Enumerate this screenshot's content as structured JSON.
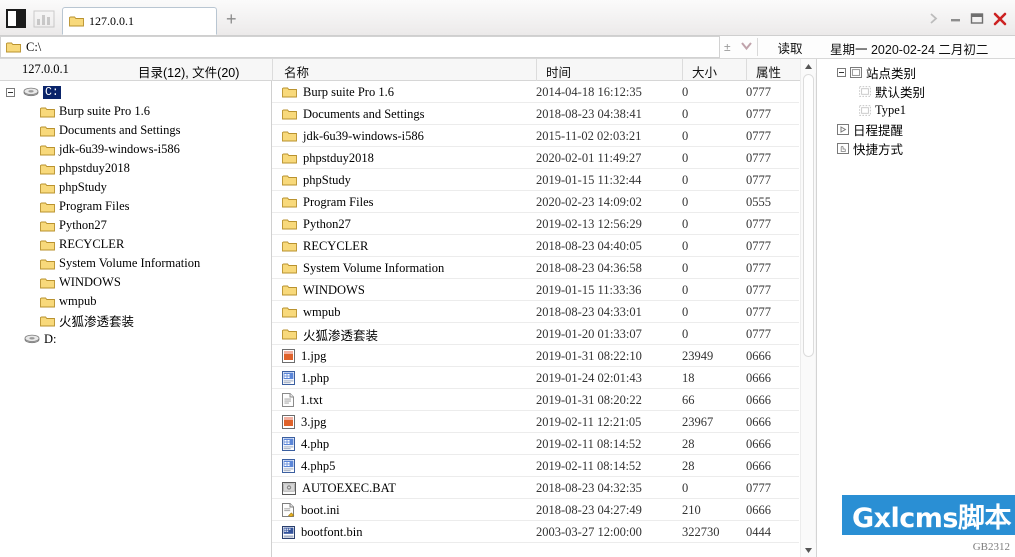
{
  "window": {
    "tab_label": "127.0.0.1",
    "new_tab_label": "+",
    "controls": {
      "expand": "»",
      "minimize": "–",
      "maximize": "□",
      "close": "✕"
    }
  },
  "address": {
    "path": "C:\\",
    "plus_minus": "±",
    "chevron": "⌄",
    "read_button": "读取",
    "date_text": "星期一 2020-02-24 二月初二"
  },
  "subheader": {
    "host": "127.0.0.1",
    "counts": "目录(12), 文件(20)"
  },
  "columns": {
    "name": "名称",
    "time": "时间",
    "size": "大小",
    "attr": "属性"
  },
  "tree": {
    "drives": [
      {
        "label": "C:",
        "selected": true,
        "expanded": true,
        "children": [
          {
            "label": "Burp suite Pro 1.6",
            "cjk": false
          },
          {
            "label": "Documents and Settings",
            "cjk": false
          },
          {
            "label": "jdk-6u39-windows-i586",
            "cjk": false
          },
          {
            "label": "phpstduy2018",
            "cjk": false
          },
          {
            "label": "phpStudy",
            "cjk": false
          },
          {
            "label": "Program Files",
            "cjk": false
          },
          {
            "label": "Python27",
            "cjk": false
          },
          {
            "label": "RECYCLER",
            "cjk": false
          },
          {
            "label": "System Volume Information",
            "cjk": false
          },
          {
            "label": "WINDOWS",
            "cjk": false
          },
          {
            "label": "wmpub",
            "cjk": false
          },
          {
            "label": "火狐渗透套装",
            "cjk": true
          }
        ]
      },
      {
        "label": "D:",
        "selected": false,
        "expanded": false,
        "children": []
      }
    ]
  },
  "files": [
    {
      "name": "Burp suite Pro 1.6",
      "icon": "folder-icon",
      "cjk": false,
      "time": "2014-04-18 16:12:35",
      "size": "0",
      "attr": "0777"
    },
    {
      "name": "Documents and Settings",
      "icon": "folder-icon",
      "cjk": false,
      "time": "2018-08-23 04:38:41",
      "size": "0",
      "attr": "0777"
    },
    {
      "name": "jdk-6u39-windows-i586",
      "icon": "folder-icon",
      "cjk": false,
      "time": "2015-11-02 02:03:21",
      "size": "0",
      "attr": "0777"
    },
    {
      "name": "phpstduy2018",
      "icon": "folder-icon",
      "cjk": false,
      "time": "2020-02-01 11:49:27",
      "size": "0",
      "attr": "0777"
    },
    {
      "name": "phpStudy",
      "icon": "folder-icon",
      "cjk": false,
      "time": "2019-01-15 11:32:44",
      "size": "0",
      "attr": "0777"
    },
    {
      "name": "Program Files",
      "icon": "folder-icon",
      "cjk": false,
      "time": "2020-02-23 14:09:02",
      "size": "0",
      "attr": "0555"
    },
    {
      "name": "Python27",
      "icon": "folder-icon",
      "cjk": false,
      "time": "2019-02-13 12:56:29",
      "size": "0",
      "attr": "0777"
    },
    {
      "name": "RECYCLER",
      "icon": "folder-icon",
      "cjk": false,
      "time": "2018-08-23 04:40:05",
      "size": "0",
      "attr": "0777"
    },
    {
      "name": "System Volume Information",
      "icon": "folder-icon",
      "cjk": false,
      "time": "2018-08-23 04:36:58",
      "size": "0",
      "attr": "0777"
    },
    {
      "name": "WINDOWS",
      "icon": "folder-icon",
      "cjk": false,
      "time": "2019-01-15 11:33:36",
      "size": "0",
      "attr": "0777"
    },
    {
      "name": "wmpub",
      "icon": "folder-icon",
      "cjk": false,
      "time": "2018-08-23 04:33:01",
      "size": "0",
      "attr": "0777"
    },
    {
      "name": "火狐渗透套装",
      "icon": "folder-icon",
      "cjk": true,
      "time": "2019-01-20 01:33:07",
      "size": "0",
      "attr": "0777"
    },
    {
      "name": "1.jpg",
      "icon": "image-file-icon",
      "cjk": false,
      "time": "2019-01-31 08:22:10",
      "size": "23949",
      "attr": "0666"
    },
    {
      "name": "1.php",
      "icon": "php-file-icon",
      "cjk": false,
      "time": "2019-01-24 02:01:43",
      "size": "18",
      "attr": "0666"
    },
    {
      "name": "1.txt",
      "icon": "text-file-icon",
      "cjk": false,
      "time": "2019-01-31 08:20:22",
      "size": "66",
      "attr": "0666"
    },
    {
      "name": "3.jpg",
      "icon": "image-file-icon",
      "cjk": false,
      "time": "2019-02-11 12:21:05",
      "size": "23967",
      "attr": "0666"
    },
    {
      "name": "4.php",
      "icon": "php-file-icon",
      "cjk": false,
      "time": "2019-02-11 08:14:52",
      "size": "28",
      "attr": "0666"
    },
    {
      "name": "4.php5",
      "icon": "php-file-icon",
      "cjk": false,
      "time": "2019-02-11 08:14:52",
      "size": "28",
      "attr": "0666"
    },
    {
      "name": "AUTOEXEC.BAT",
      "icon": "batch-file-icon",
      "cjk": false,
      "time": "2018-08-23 04:32:35",
      "size": "0",
      "attr": "0777"
    },
    {
      "name": "boot.ini",
      "icon": "config-file-icon",
      "cjk": false,
      "time": "2018-08-23 04:27:49",
      "size": "210",
      "attr": "0666"
    },
    {
      "name": "bootfont.bin",
      "icon": "binary-file-icon",
      "cjk": false,
      "time": "2003-03-27 12:00:00",
      "size": "322730",
      "attr": "0444"
    }
  ],
  "sidebar": {
    "nodes": [
      {
        "label": "站点类别",
        "icon": "category-icon",
        "depth": 0,
        "expander": true,
        "mono": false
      },
      {
        "label": "默认类别",
        "icon": "subcategory-icon",
        "depth": 1,
        "expander": false,
        "mono": false
      },
      {
        "label": "Type1",
        "icon": "subcategory-icon",
        "depth": 1,
        "expander": false,
        "mono": true
      },
      {
        "label": "日程提醒",
        "icon": "reminder-icon",
        "depth": 0,
        "expander": false,
        "mono": false
      },
      {
        "label": "快捷方式",
        "icon": "shortcut-icon",
        "depth": 0,
        "expander": false,
        "mono": false
      }
    ]
  },
  "watermark": {
    "text": "Gxlcms脚本",
    "code": "GB2312",
    "color": "#2a8fd4"
  }
}
